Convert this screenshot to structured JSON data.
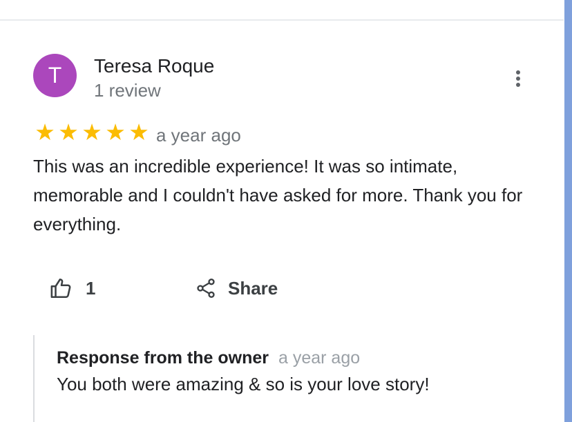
{
  "review": {
    "avatar_letter": "T",
    "avatar_color": "#ab47bc",
    "reviewer_name": "Teresa Roque",
    "review_count": "1 review",
    "rating": 5,
    "rating_max": 5,
    "star_glyph": "★",
    "star_color": "#fbbc04",
    "date": "a year ago",
    "text": "This was an incredible experience! It was so intimate, memorable and I couldn't have asked for more. Thank you for everything.",
    "more_icon": "more-vert-icon"
  },
  "actions": {
    "like_icon": "thumb-up-icon",
    "like_count": "1",
    "share_icon": "share-icon",
    "share_label": "Share"
  },
  "owner_response": {
    "title": "Response from the owner",
    "date": "a year ago",
    "text": "You both were amazing & so is your love story!"
  },
  "colors": {
    "scrollbar": "#7fa0dc",
    "primary_text": "#202124",
    "secondary_text": "#70757a"
  }
}
